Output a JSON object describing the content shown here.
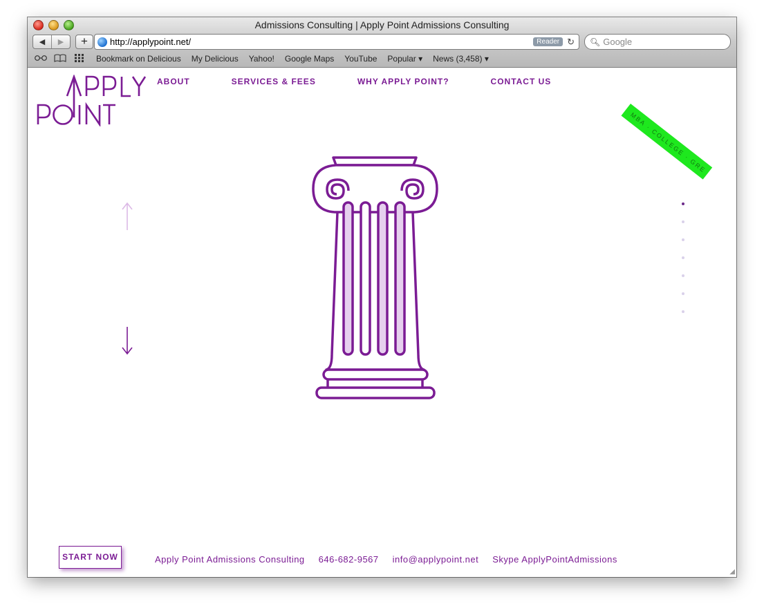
{
  "window": {
    "title": "Admissions Consulting | Apply Point Admissions Consulting"
  },
  "toolbar": {
    "back_label": "◀",
    "forward_label": "▶",
    "add_label": "+",
    "url": "http://applypoint.net/",
    "reader_label": "Reader",
    "reload_label": "↻",
    "search_placeholder": "Google"
  },
  "bookmarks": {
    "icons": [
      "reading-list-icon",
      "bookmarks-book-icon",
      "top-sites-grid-icon"
    ],
    "items": [
      {
        "label": "Bookmark on Delicious"
      },
      {
        "label": "My Delicious"
      },
      {
        "label": "Yahoo!"
      },
      {
        "label": "Google Maps"
      },
      {
        "label": "YouTube"
      },
      {
        "label": "Popular ▾"
      },
      {
        "label": "News (3,458) ▾"
      }
    ]
  },
  "site": {
    "logo_line1": "APPLY",
    "logo_line2": "POINT",
    "brand_color": "#7b1c94",
    "nav": [
      {
        "label": "ABOUT"
      },
      {
        "label": "SERVICES & FEES"
      },
      {
        "label": "WHY APPLY POINT?"
      },
      {
        "label": "CONTACT US"
      }
    ],
    "ribbon_text": "MBA · COLLEGE · GRE",
    "ribbon_color": "#1ee81e",
    "slide_count": 7,
    "active_slide": 1,
    "start_button": "START NOW",
    "footer": {
      "company": "Apply Point Admissions Consulting",
      "phone": "646-682-9567",
      "email": "info@applypoint.net",
      "skype": "Skype ApplyPointAdmissions"
    }
  }
}
